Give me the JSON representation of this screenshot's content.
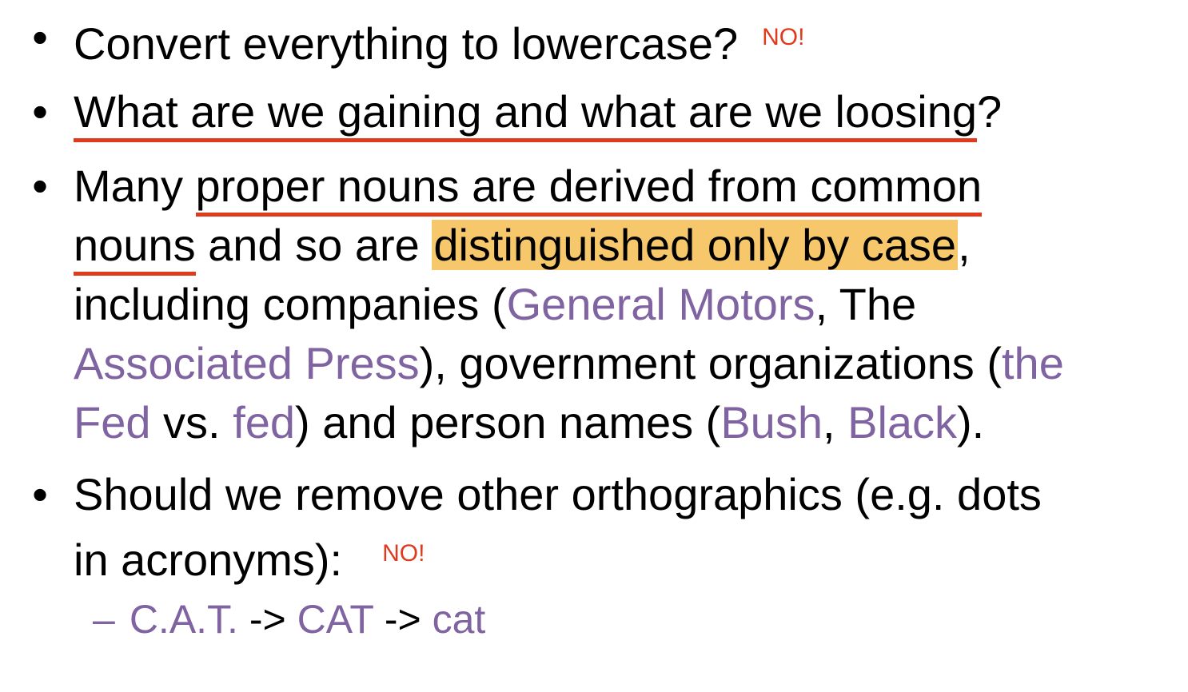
{
  "bullets": [
    {
      "marker": "•",
      "lines": [
        {
          "parts": [
            "Convert everything to lowercase?"
          ],
          "note": "NO!"
        }
      ]
    },
    {
      "marker": "•",
      "lines": [
        {
          "parts": [
            "What are we gaining and what are we loosing",
            "?"
          ]
        }
      ]
    },
    {
      "marker": "•",
      "lines": [
        {
          "parts": [
            "Many ",
            "proper nouns are derived from common"
          ]
        },
        {
          "parts": [
            "nouns",
            " and so are ",
            "distinguished only by case",
            ","
          ]
        },
        {
          "parts": [
            "including companies (",
            "General Motors",
            ", The"
          ]
        },
        {
          "parts": [
            "Associated Press",
            "), government organizations (",
            "the"
          ]
        },
        {
          "parts": [
            "Fed",
            " vs. ",
            "fed",
            ") and person names (",
            "Bush",
            ", ",
            "Black",
            ")."
          ]
        }
      ]
    },
    {
      "marker": "•",
      "lines": [
        {
          "parts": [
            "Should we remove other orthographics (e.g. dots"
          ]
        },
        {
          "parts": [
            "in acronyms):"
          ],
          "note": "NO!"
        }
      ]
    }
  ],
  "sub_bullet": {
    "dash": "–",
    "parts": [
      "C.A.T.",
      " -> ",
      "CAT",
      " -> ",
      "cat"
    ]
  },
  "colors": {
    "text": "#000000",
    "purple": "#8064a2",
    "red": "#e03a1e",
    "highlight": "#f6c86b"
  }
}
